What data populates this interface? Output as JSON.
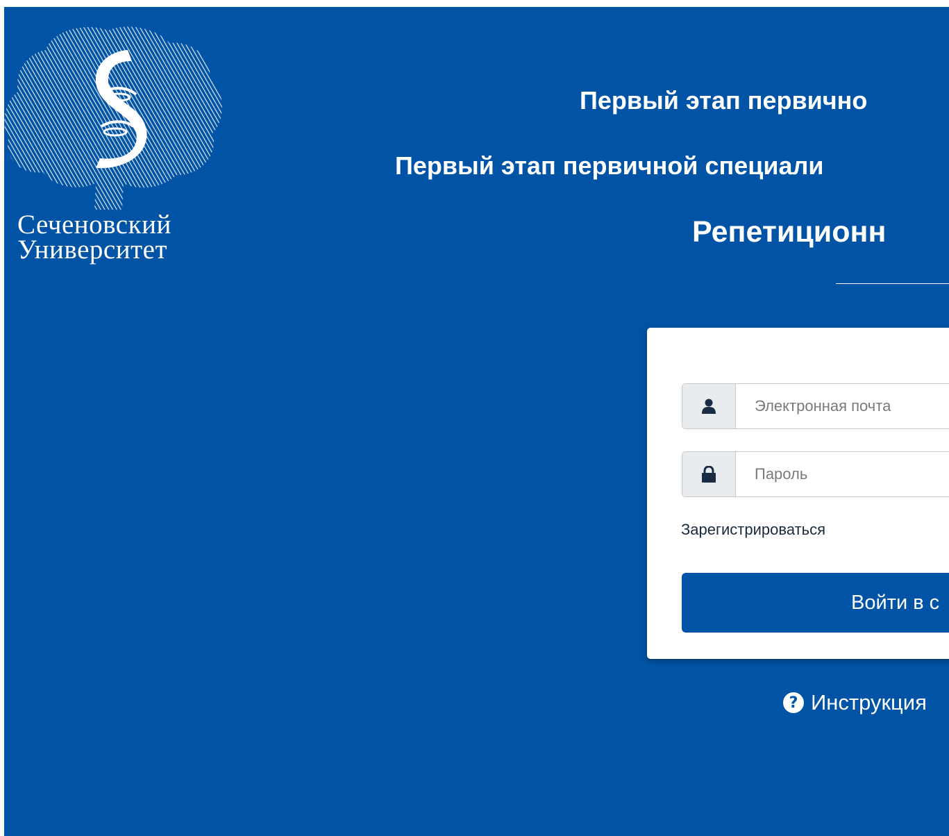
{
  "brand": {
    "name_line1": "Сеченовский",
    "name_line2": "Университет",
    "background_color": "#0053a5",
    "logo_icon": "tree-dna-icon"
  },
  "header": {
    "line1": "Первый этап первично",
    "line2": "Первый этап первичной специали",
    "line3": "Репетиционн"
  },
  "login_form": {
    "email_placeholder": "Электронная почта",
    "email_icon": "user-icon",
    "password_placeholder": "Пароль",
    "password_icon": "lock-icon",
    "register_link": "Зарегистрироваться",
    "submit_label": "Войти в с"
  },
  "footer": {
    "help_label": "Инструкция",
    "help_icon": "question-circle-icon"
  }
}
